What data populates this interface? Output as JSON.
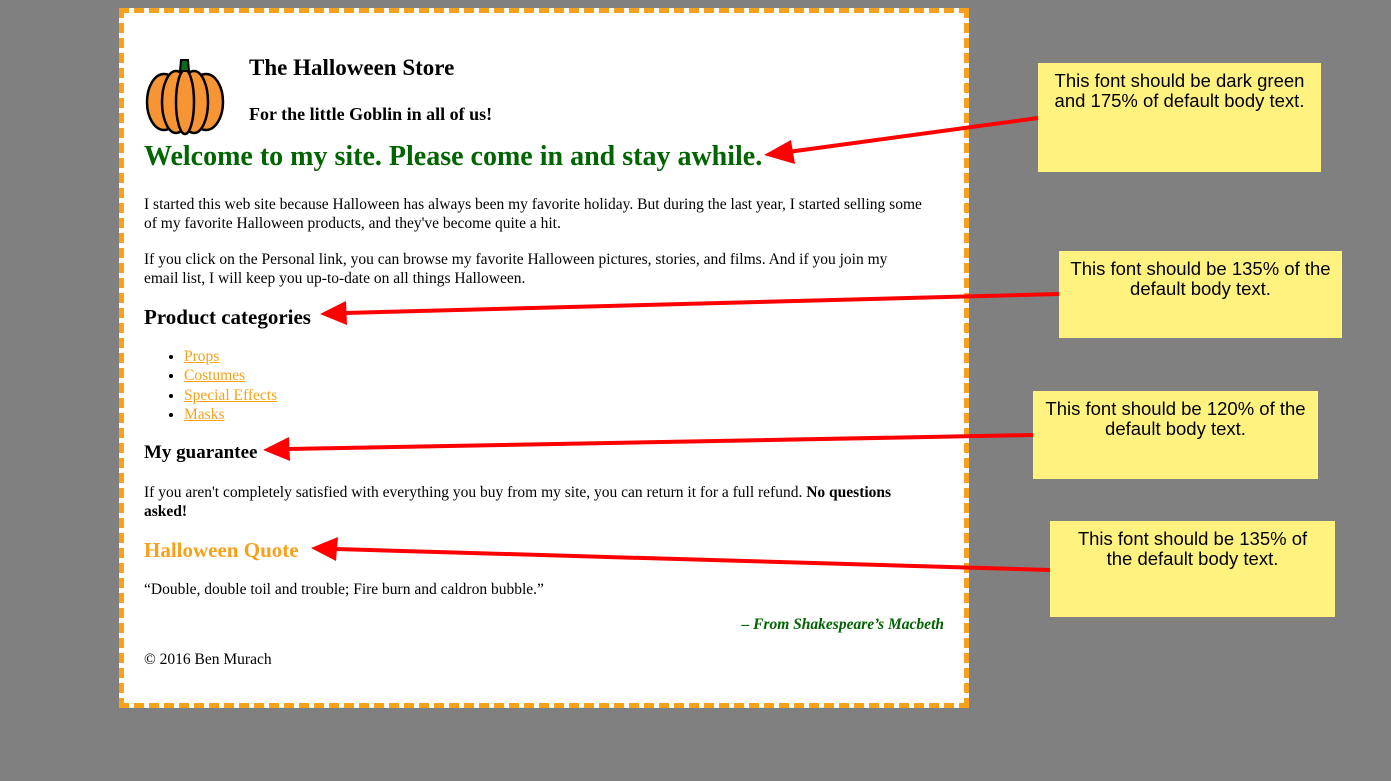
{
  "site": {
    "title": "The Halloween Store",
    "tagline": "For the little Goblin in all of us!",
    "welcome": "Welcome to my site. Please come in and stay awhile.",
    "intro_paragraph": "I started this web site because Halloween has always been my favorite holiday. But during the last year, I started selling some of my favorite Halloween products, and they've become quite a hit.",
    "personal_paragraph": "If you click on the Personal link, you can browse my favorite Halloween pictures, stories, and films. And if you join my email list, I will keep you up-to-date on all things Halloween.",
    "categories_heading": "Product categories",
    "categories": [
      "Props",
      "Costumes",
      "Special Effects",
      "Masks"
    ],
    "guarantee_heading": "My guarantee",
    "guarantee_text": "If you aren't completely satisfied with everything you buy from my site, you can return it for a full refund. ",
    "guarantee_emphasis": "No questions asked!",
    "quote_heading": "Halloween Quote",
    "quote": "“Double, double toil and trouble; Fire burn and caldron bubble.”",
    "quote_attribution": "– From Shakespeare’s Macbeth",
    "copyright": "© 2016 Ben Murach"
  },
  "annotations": [
    "This font should be dark green and 175% of default body text.",
    "This font should be 135% of the default body text.",
    "This font should be 120% of the default body text.",
    "This font should be 135% of the default body text."
  ],
  "colors": {
    "background": "#808080",
    "page": "#ffffff",
    "border": "#f7a11a",
    "dark_green": "#006400",
    "orange": "#f7a11a",
    "note": "#fff27f",
    "arrow": "#ff0000"
  },
  "icons": {
    "logo": "pumpkin-icon"
  }
}
